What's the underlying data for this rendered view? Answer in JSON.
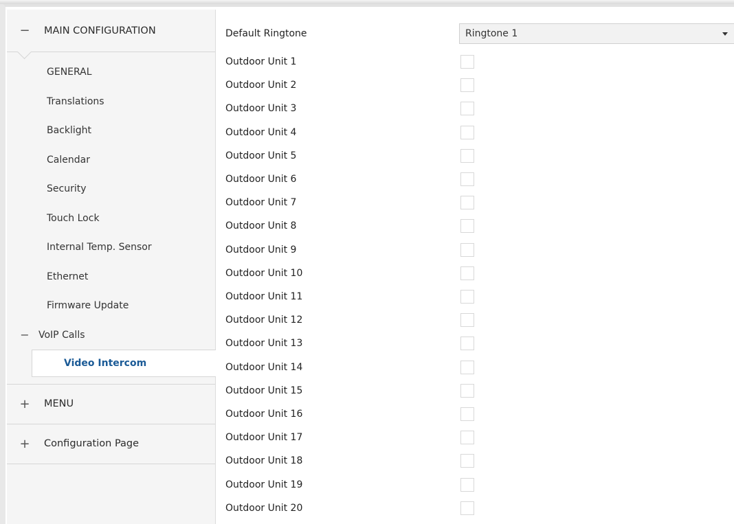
{
  "sidebar": {
    "main_group": {
      "sign": "−",
      "label": "MAIN CONFIGURATION"
    },
    "items": [
      {
        "label": "GENERAL"
      },
      {
        "label": "Translations"
      },
      {
        "label": "Backlight"
      },
      {
        "label": "Calendar"
      },
      {
        "label": "Security"
      },
      {
        "label": "Touch Lock"
      },
      {
        "label": "Internal Temp. Sensor"
      },
      {
        "label": "Ethernet"
      },
      {
        "label": "Firmware Update"
      }
    ],
    "voip": {
      "sign": "−",
      "label": "VoIP Calls"
    },
    "active_item": {
      "label": "Video Intercom"
    },
    "menu_group": {
      "sign": "+",
      "label": "MENU"
    },
    "config_group": {
      "sign": "+",
      "label": "Configuration Page"
    }
  },
  "content": {
    "ringtone": {
      "label": "Default Ringtone",
      "value": "Ringtone 1"
    },
    "units": [
      {
        "label": "Outdoor Unit 1",
        "checked": false
      },
      {
        "label": "Outdoor Unit 2",
        "checked": false
      },
      {
        "label": "Outdoor Unit 3",
        "checked": false
      },
      {
        "label": "Outdoor Unit 4",
        "checked": false
      },
      {
        "label": "Outdoor Unit 5",
        "checked": false
      },
      {
        "label": "Outdoor Unit 6",
        "checked": false
      },
      {
        "label": "Outdoor Unit 7",
        "checked": false
      },
      {
        "label": "Outdoor Unit 8",
        "checked": false
      },
      {
        "label": "Outdoor Unit 9",
        "checked": false
      },
      {
        "label": "Outdoor Unit 10",
        "checked": false
      },
      {
        "label": "Outdoor Unit 11",
        "checked": false
      },
      {
        "label": "Outdoor Unit 12",
        "checked": false
      },
      {
        "label": "Outdoor Unit 13",
        "checked": false
      },
      {
        "label": "Outdoor Unit 14",
        "checked": false
      },
      {
        "label": "Outdoor Unit 15",
        "checked": false
      },
      {
        "label": "Outdoor Unit 16",
        "checked": false
      },
      {
        "label": "Outdoor Unit 17",
        "checked": false
      },
      {
        "label": "Outdoor Unit 18",
        "checked": false
      },
      {
        "label": "Outdoor Unit 19",
        "checked": false
      },
      {
        "label": "Outdoor Unit 20",
        "checked": false
      }
    ]
  },
  "colors": {
    "active_text": "#1a5a96",
    "sidebar_bg": "#f5f5f5",
    "border": "#d6d6d6"
  }
}
